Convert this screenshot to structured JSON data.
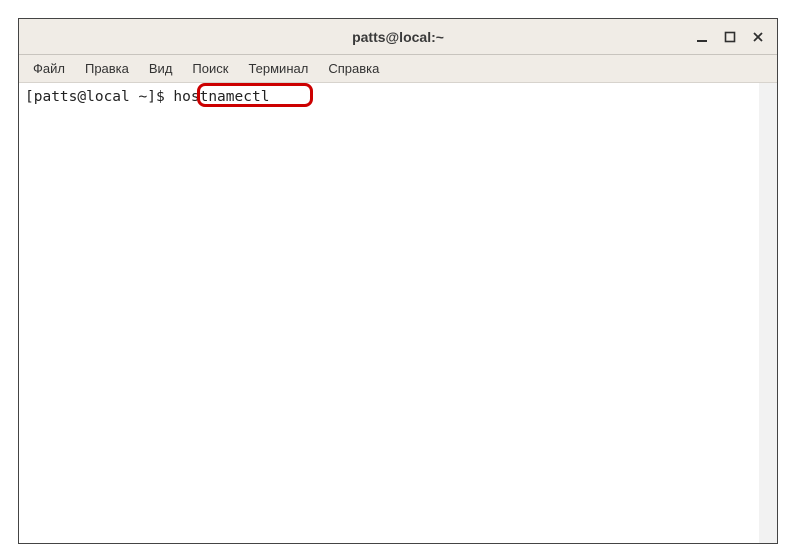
{
  "window": {
    "title": "patts@local:~"
  },
  "menubar": {
    "file": "Файл",
    "edit": "Правка",
    "view": "Вид",
    "search": "Поиск",
    "terminal": "Терминал",
    "help": "Справка"
  },
  "terminal": {
    "prompt": "[patts@local ~]$ ",
    "command": "hostnamectl"
  }
}
